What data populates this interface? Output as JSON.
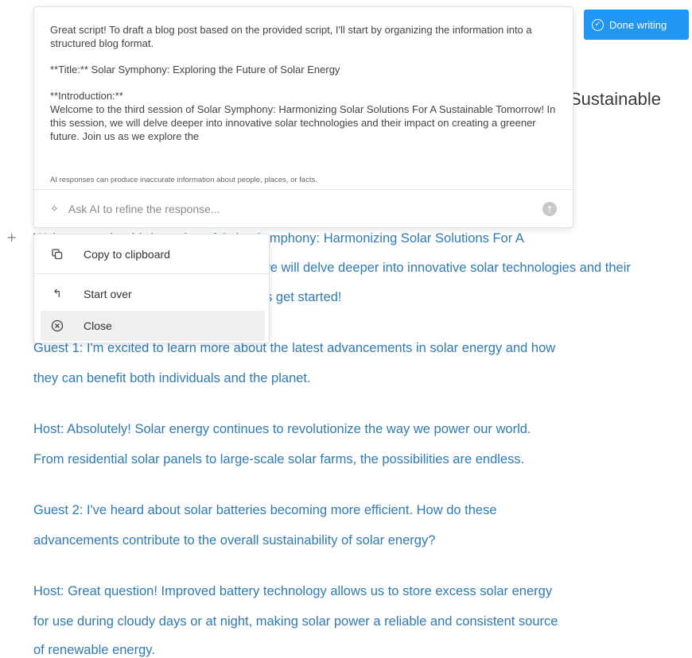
{
  "toolbar": {
    "done_label": "Done writing"
  },
  "document": {
    "heading_fragment": "Sustainable",
    "lines": [
      "Welcome to the third session of Solar Symphony: Harmonizing Solar Solutions For A",
      "Sustainable Tomorrow! In this session, we will delve deeper into innovative solar technologies and their",
      "impact on creating a greener future. Let's get started!",
      "Guest 1: I'm excited to learn more about the latest advancements in solar energy and how",
      "they can benefit both individuals and the planet.",
      "Host: Absolutely! Solar energy continues to revolutionize the way we power our world.",
      "From residential solar panels to large-scale solar farms, the possibilities are endless.",
      "Guest 2: I've heard about solar batteries becoming more efficient. How do these",
      "advancements contribute to the overall sustainability of solar energy?",
      "Host: Great question! Improved battery technology allows us to store excess solar energy",
      "for use during cloudy days or at night, making solar power a reliable and consistent source",
      "of renewable energy."
    ]
  },
  "ai_panel": {
    "response": {
      "intro": "Great script! To draft a blog post based on the provided script, I'll start by organizing the information into a structured blog format.",
      "title_line": "**Title:** Solar Symphony: Exploring the Future of Solar Energy",
      "intro_heading": "**Introduction:**",
      "intro_body": "Welcome to the third session of Solar Symphony: Harmonizing Solar Solutions For A Sustainable Tomorrow! In this session, we will delve deeper into innovative solar technologies and their impact on creating a greener future. Join us as we explore the"
    },
    "disclaimer": "AI responses can produce inaccurate information about people, places, or facts.",
    "input_placeholder": "Ask AI to refine the response..."
  },
  "menu": {
    "copy_label": "Copy to clipboard",
    "start_over_label": "Start over",
    "close_label": "Close"
  },
  "icons": {
    "plus": "plus-icon",
    "check_circle": "check-circle-icon",
    "sparkle": "sparkle-icon",
    "send": "send-icon",
    "copy": "copy-icon",
    "undo": "undo-arrow-icon",
    "close": "close-circle-icon"
  },
  "colors": {
    "accent": "#2196f3",
    "document_text": "#2f7bb5"
  }
}
